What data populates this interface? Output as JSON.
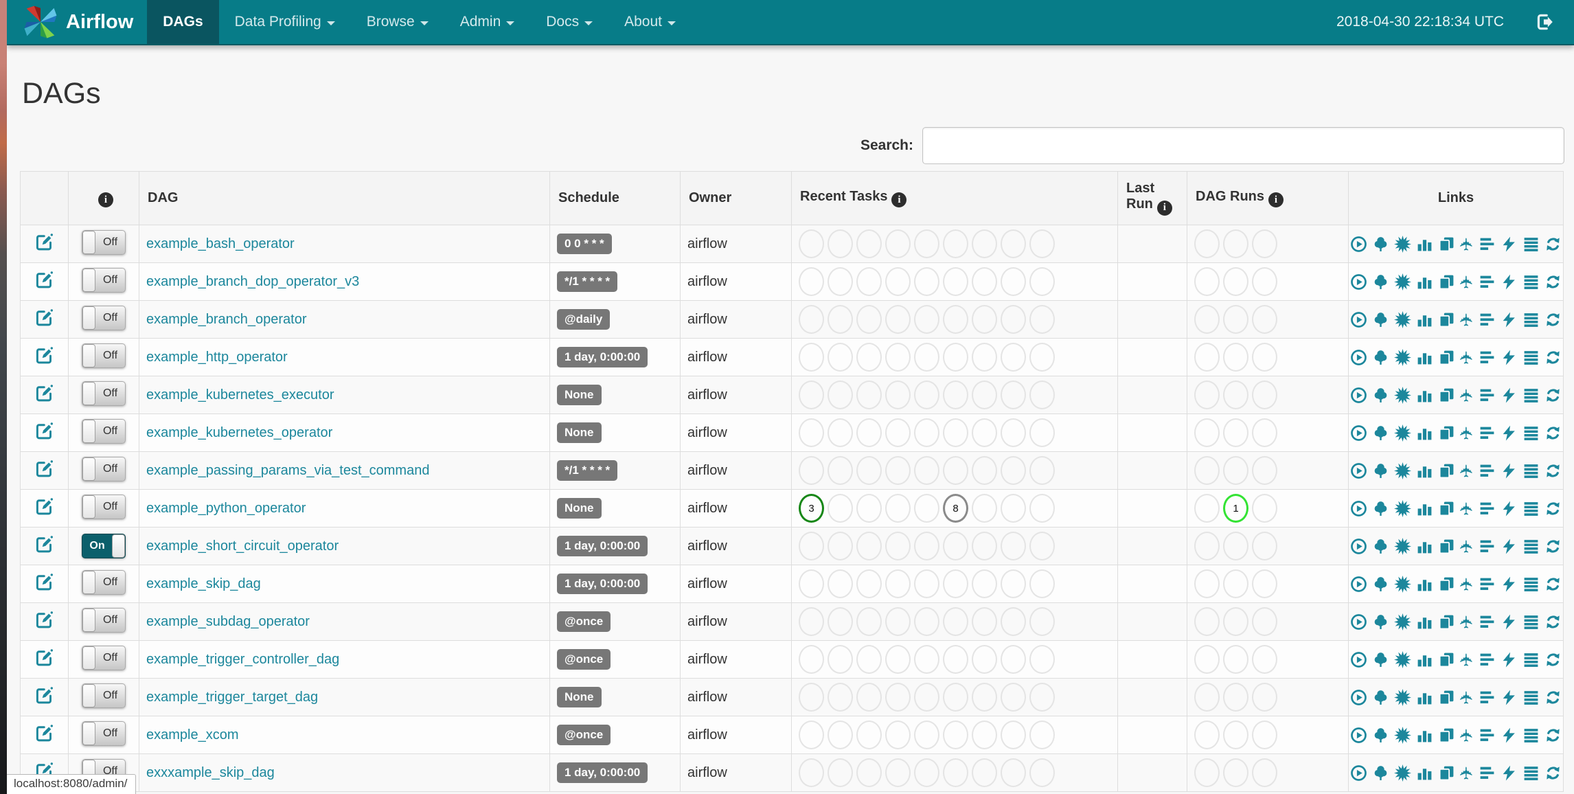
{
  "navbar": {
    "brand": "Airflow",
    "items": [
      {
        "label": "DAGs",
        "active": true,
        "caret": false
      },
      {
        "label": "Data Profiling",
        "active": false,
        "caret": true
      },
      {
        "label": "Browse",
        "active": false,
        "caret": true
      },
      {
        "label": "Admin",
        "active": false,
        "caret": true
      },
      {
        "label": "Docs",
        "active": false,
        "caret": true
      },
      {
        "label": "About",
        "active": false,
        "caret": true
      }
    ],
    "clock": "2018-04-30 22:18:34 UTC"
  },
  "page": {
    "title": "DAGs",
    "search_label": "Search:",
    "search_value": "",
    "status_url": "localhost:8080/admin/"
  },
  "toggle_labels": {
    "on": "On",
    "off": "Off"
  },
  "colors": {
    "navbar": "#077c88",
    "navbar_active": "#0a5560",
    "accent": "#1c879c",
    "badge": "#777777",
    "states": {
      "empty": "#e4e4e4",
      "success": "#178717",
      "running": "#33e333",
      "none": "#8a8a8a"
    }
  },
  "table": {
    "headers": {
      "dag": "DAG",
      "schedule": "Schedule",
      "owner": "Owner",
      "recent_tasks": "Recent Tasks",
      "last_run": "Last Run",
      "dag_runs": "DAG Runs",
      "links": "Links"
    },
    "recent_slots": 9,
    "run_slots": 3,
    "links_icons": [
      "trigger-dag",
      "tree-view",
      "graph-view",
      "task-duration",
      "task-tries",
      "landing-times",
      "gantt",
      "code",
      "logs",
      "refresh"
    ],
    "rows": [
      {
        "name": "example_bash_operator",
        "schedule": "0 0 * * *",
        "owner": "airflow",
        "enabled": false,
        "recent_tasks": [],
        "dag_runs": []
      },
      {
        "name": "example_branch_dop_operator_v3",
        "schedule": "*/1 * * * *",
        "owner": "airflow",
        "enabled": false,
        "recent_tasks": [],
        "dag_runs": []
      },
      {
        "name": "example_branch_operator",
        "schedule": "@daily",
        "owner": "airflow",
        "enabled": false,
        "recent_tasks": [],
        "dag_runs": []
      },
      {
        "name": "example_http_operator",
        "schedule": "1 day, 0:00:00",
        "owner": "airflow",
        "enabled": false,
        "recent_tasks": [],
        "dag_runs": []
      },
      {
        "name": "example_kubernetes_executor",
        "schedule": "None",
        "owner": "airflow",
        "enabled": false,
        "recent_tasks": [],
        "dag_runs": []
      },
      {
        "name": "example_kubernetes_operator",
        "schedule": "None",
        "owner": "airflow",
        "enabled": false,
        "recent_tasks": [],
        "dag_runs": []
      },
      {
        "name": "example_passing_params_via_test_command",
        "schedule": "*/1 * * * *",
        "owner": "airflow",
        "enabled": false,
        "recent_tasks": [],
        "dag_runs": []
      },
      {
        "name": "example_python_operator",
        "schedule": "None",
        "owner": "airflow",
        "enabled": false,
        "recent_tasks": [
          {
            "slot": 0,
            "count": "3",
            "state": "success"
          },
          {
            "slot": 5,
            "count": "8",
            "state": "none"
          }
        ],
        "dag_runs": [
          {
            "slot": 1,
            "count": "1",
            "state": "running"
          }
        ]
      },
      {
        "name": "example_short_circuit_operator",
        "schedule": "1 day, 0:00:00",
        "owner": "airflow",
        "enabled": true,
        "recent_tasks": [],
        "dag_runs": []
      },
      {
        "name": "example_skip_dag",
        "schedule": "1 day, 0:00:00",
        "owner": "airflow",
        "enabled": false,
        "recent_tasks": [],
        "dag_runs": []
      },
      {
        "name": "example_subdag_operator",
        "schedule": "@once",
        "owner": "airflow",
        "enabled": false,
        "recent_tasks": [],
        "dag_runs": []
      },
      {
        "name": "example_trigger_controller_dag",
        "schedule": "@once",
        "owner": "airflow",
        "enabled": false,
        "recent_tasks": [],
        "dag_runs": []
      },
      {
        "name": "example_trigger_target_dag",
        "schedule": "None",
        "owner": "airflow",
        "enabled": false,
        "recent_tasks": [],
        "dag_runs": []
      },
      {
        "name": "example_xcom",
        "schedule": "@once",
        "owner": "airflow",
        "enabled": false,
        "recent_tasks": [],
        "dag_runs": []
      },
      {
        "name": "exxxample_skip_dag",
        "schedule": "1 day, 0:00:00",
        "owner": "airflow",
        "enabled": false,
        "recent_tasks": [],
        "dag_runs": []
      }
    ]
  }
}
